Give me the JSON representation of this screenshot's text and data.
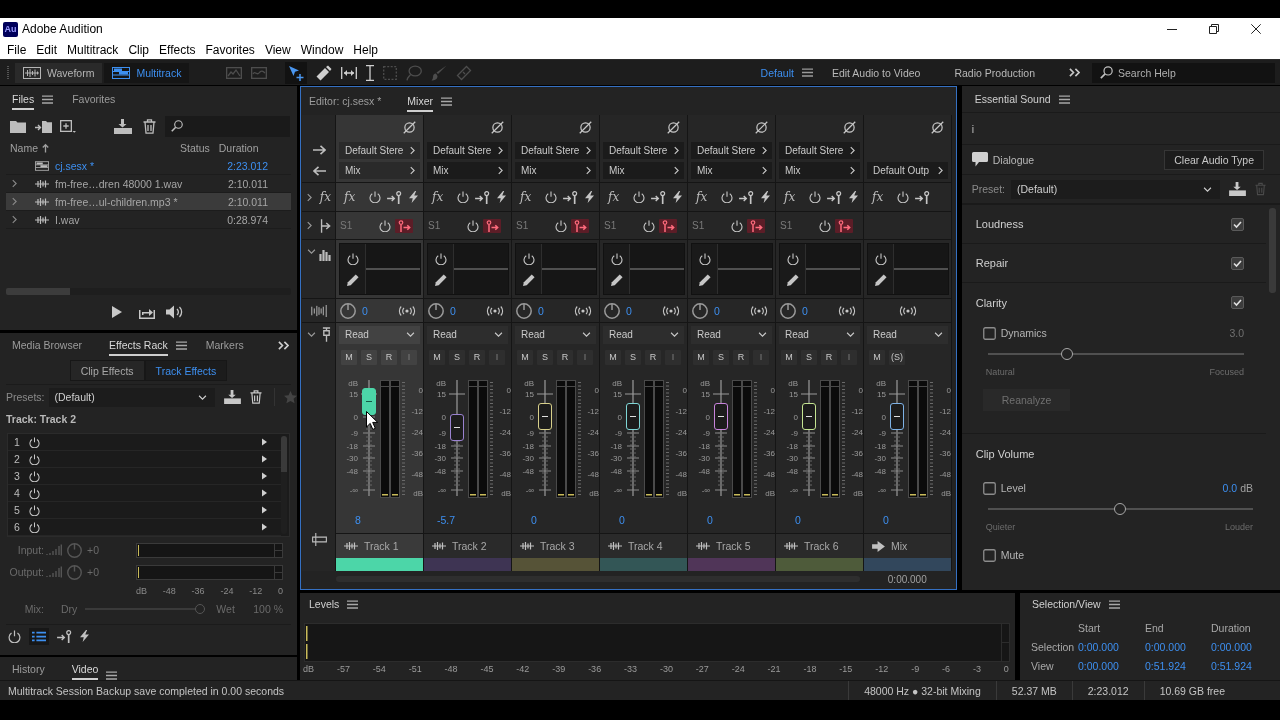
{
  "window": {
    "logo": "Au",
    "title": "Adobe Audition"
  },
  "menu": [
    "File",
    "Edit",
    "Multitrack",
    "Clip",
    "Effects",
    "Favorites",
    "View",
    "Window",
    "Help"
  ],
  "toolbar": {
    "modes": [
      {
        "kind": "waveform",
        "label": "Waveform",
        "selected": false
      },
      {
        "kind": "multitrack",
        "label": "Multitrack",
        "selected": true
      }
    ],
    "tools": [
      {
        "kind": "frequency",
        "selected": false,
        "disabled": true
      },
      {
        "kind": "pitch",
        "selected": false,
        "disabled": true
      },
      {
        "kind": "move",
        "selected": true,
        "disabled": false
      },
      {
        "kind": "razor",
        "selected": false,
        "disabled": false
      },
      {
        "kind": "slip",
        "selected": false,
        "disabled": false
      },
      {
        "kind": "time",
        "selected": false,
        "disabled": false
      },
      {
        "kind": "marquee",
        "selected": false,
        "disabled": true
      },
      {
        "kind": "lasso",
        "selected": false,
        "disabled": true
      },
      {
        "kind": "brush",
        "selected": false,
        "disabled": true
      },
      {
        "kind": "heal",
        "selected": false,
        "disabled": true
      }
    ],
    "workspaces": [
      {
        "label": "Default",
        "selected": true
      },
      {
        "label": "Edit Audio to Video",
        "selected": false
      },
      {
        "label": "Radio Production",
        "selected": false
      }
    ],
    "search": {
      "placeholder": "Search Help"
    }
  },
  "files_panel": {
    "tabs": [
      {
        "label": "Files",
        "selected": true
      },
      {
        "label": "Favorites",
        "selected": false
      }
    ],
    "columns": [
      "Name",
      "Status",
      "Duration"
    ],
    "rows": [
      {
        "kind": "session",
        "name": "cj.sesx *",
        "duration": "2:23.012",
        "selected": false
      },
      {
        "kind": "audio",
        "name": "fm-free…dren 48000 1.wav",
        "duration": "2:10.011",
        "selected": false,
        "expanded": false
      },
      {
        "kind": "audio",
        "name": "fm-free…ul-children.mp3 *",
        "duration": "2:10.011",
        "selected": true,
        "expanded": false
      },
      {
        "kind": "audio",
        "name": "I.wav",
        "duration": "0:28.974",
        "selected": false,
        "expanded": false
      }
    ]
  },
  "effects_rack": {
    "tabs": [
      {
        "label": "Media Browser",
        "selected": false
      },
      {
        "label": "Effects Rack",
        "selected": true
      },
      {
        "label": "Markers",
        "selected": false
      }
    ],
    "modes": [
      {
        "label": "Clip Effects",
        "selected": false
      },
      {
        "label": "Track Effects",
        "selected": true
      }
    ],
    "presets": {
      "label": "Presets:",
      "value": "(Default)",
      "favorite_disabled": true
    },
    "track_label": "Track: Track 2",
    "slots": [
      "1",
      "2",
      "3",
      "4",
      "5",
      "6"
    ],
    "input": {
      "label": "Input:",
      "value": "+0",
      "disabled": true
    },
    "output": {
      "label": "Output:",
      "value": "+0",
      "disabled": true
    },
    "meter_ticks": [
      "dB",
      "-48",
      "-36",
      "-24",
      "-12",
      "0"
    ],
    "mix": {
      "label": "Mix:",
      "dry": "Dry",
      "wet": "Wet",
      "reading": "100 %",
      "level": 1,
      "disabled": true
    },
    "buttons": [
      {
        "kind": "power",
        "selected": false
      },
      {
        "kind": "list",
        "selected": true
      },
      {
        "kind": "insert",
        "selected": false
      },
      {
        "kind": "bolt",
        "selected": false
      }
    ]
  },
  "bottom_tabs": [
    {
      "label": "History",
      "selected": false
    },
    {
      "label": "Video",
      "selected": true
    }
  ],
  "mixer": {
    "tabs": [
      {
        "label": "Editor: cj.sesx *",
        "selected": false
      },
      {
        "label": "Mixer",
        "selected": true
      }
    ],
    "side": {
      "fx": "fx",
      "sections": [
        {
          "kind": "fx",
          "expanded": false
        },
        {
          "kind": "sends",
          "expanded": false
        },
        {
          "kind": "eq",
          "expanded": true
        },
        {
          "kind": "automation",
          "expanded": true
        }
      ]
    },
    "channels": [
      {
        "kind": "track",
        "name": "Track 1",
        "selected": true,
        "color": "#4cd6a8",
        "input": "Default Stere",
        "output": "Mix",
        "fx": "fx",
        "send": "S1",
        "pan": "0",
        "automation": "Read",
        "buttons": [
          {
            "label": "M",
            "disabled": false
          },
          {
            "label": "S",
            "disabled": false
          },
          {
            "label": "R",
            "disabled": false
          },
          {
            "label": "I",
            "disabled": true
          }
        ],
        "fader_scale": [
          "dB",
          "15",
          "0",
          "-9",
          "-18",
          "-30",
          "-48",
          "-∞"
        ],
        "level": 0.81,
        "meter_scale": [
          "0",
          "-12",
          "-24",
          "-36",
          "-48",
          "dB"
        ],
        "volume": "8"
      },
      {
        "kind": "track",
        "name": "Track 2",
        "selected": false,
        "color": "#9a82d0",
        "input": "Default Stere",
        "output": "Mix",
        "fx": "fx",
        "send": "S1",
        "pan": "0",
        "automation": "Read",
        "buttons": [
          {
            "label": "M",
            "disabled": false
          },
          {
            "label": "S",
            "disabled": false
          },
          {
            "label": "R",
            "disabled": false
          },
          {
            "label": "I",
            "disabled": true
          }
        ],
        "fader_scale": [
          "dB",
          "15",
          "0",
          "-9",
          "-18",
          "-30",
          "-48",
          "-∞"
        ],
        "level": 0.59,
        "meter_scale": [
          "0",
          "-12",
          "-24",
          "-36",
          "-48",
          "dB"
        ],
        "volume": "-5.7"
      },
      {
        "kind": "track",
        "name": "Track 3",
        "selected": false,
        "color": "#d8d08a",
        "input": "Default Stere",
        "output": "Mix",
        "fx": "fx",
        "send": "S1",
        "pan": "0",
        "automation": "Read",
        "buttons": [
          {
            "label": "M",
            "disabled": false
          },
          {
            "label": "S",
            "disabled": false
          },
          {
            "label": "R",
            "disabled": false
          },
          {
            "label": "I",
            "disabled": true
          }
        ],
        "fader_scale": [
          "dB",
          "15",
          "0",
          "-9",
          "-18",
          "-30",
          "-48",
          "-∞"
        ],
        "level": 0.68,
        "meter_scale": [
          "0",
          "-12",
          "-24",
          "-36",
          "-48",
          "dB"
        ],
        "volume": "0"
      },
      {
        "kind": "track",
        "name": "Track 4",
        "selected": false,
        "color": "#7fd6d6",
        "input": "Default Stere",
        "output": "Mix",
        "fx": "fx",
        "send": "S1",
        "pan": "0",
        "automation": "Read",
        "buttons": [
          {
            "label": "M",
            "disabled": false
          },
          {
            "label": "S",
            "disabled": false
          },
          {
            "label": "R",
            "disabled": false
          },
          {
            "label": "I",
            "disabled": true
          }
        ],
        "fader_scale": [
          "dB",
          "15",
          "0",
          "-9",
          "-18",
          "-30",
          "-48",
          "-∞"
        ],
        "level": 0.68,
        "meter_scale": [
          "0",
          "-12",
          "-24",
          "-36",
          "-48",
          "dB"
        ],
        "volume": "0"
      },
      {
        "kind": "track",
        "name": "Track 5",
        "selected": false,
        "color": "#c884dc",
        "input": "Default Stere",
        "output": "Mix",
        "fx": "fx",
        "send": "S1",
        "pan": "0",
        "automation": "Read",
        "buttons": [
          {
            "label": "M",
            "disabled": false
          },
          {
            "label": "S",
            "disabled": false
          },
          {
            "label": "R",
            "disabled": false
          },
          {
            "label": "I",
            "disabled": true
          }
        ],
        "fader_scale": [
          "dB",
          "15",
          "0",
          "-9",
          "-18",
          "-30",
          "-48",
          "-∞"
        ],
        "level": 0.68,
        "meter_scale": [
          "0",
          "-12",
          "-24",
          "-36",
          "-48",
          "dB"
        ],
        "volume": "0"
      },
      {
        "kind": "track",
        "name": "Track 6",
        "selected": false,
        "color": "#c4e491",
        "input": "Default Stere",
        "output": "Mix",
        "fx": "fx",
        "send": "S1",
        "pan": "0",
        "automation": "Read",
        "buttons": [
          {
            "label": "M",
            "disabled": false
          },
          {
            "label": "S",
            "disabled": false
          },
          {
            "label": "R",
            "disabled": false
          },
          {
            "label": "I",
            "disabled": true
          }
        ],
        "fader_scale": [
          "dB",
          "15",
          "0",
          "-9",
          "-18",
          "-30",
          "-48",
          "-∞"
        ],
        "level": 0.68,
        "meter_scale": [
          "0",
          "-12",
          "-24",
          "-36",
          "-48",
          "dB"
        ],
        "volume": "0"
      },
      {
        "kind": "master",
        "name": "Mix",
        "selected": false,
        "color": "#7eb2e6",
        "output": "Default Outp",
        "fx": "fx",
        "automation": "Read",
        "buttons": [
          {
            "label": "M",
            "disabled": false
          },
          {
            "label": "(S)",
            "disabled": false
          }
        ],
        "fader_scale": [
          "dB",
          "15",
          "0",
          "-9",
          "-18",
          "-30",
          "-48",
          "-∞"
        ],
        "level": 0.68,
        "meter_scale": [
          "0",
          "-12",
          "-24",
          "-36",
          "-48",
          "dB"
        ],
        "volume": "0"
      }
    ],
    "time": "0:00.000"
  },
  "essential_sound": {
    "title": "Essential Sound",
    "clip": "i",
    "audio_type": "Dialogue",
    "clear_button": "Clear Audio Type",
    "preset": {
      "label": "Preset:",
      "value": "(Default)",
      "delete_disabled": true
    },
    "sections": [
      {
        "title": "Loudness",
        "checked": true
      },
      {
        "title": "Repair",
        "checked": true
      },
      {
        "title": "Clarity",
        "checked": true,
        "dynamics": {
          "label": "Dynamics",
          "checked": false,
          "reading": "3.0",
          "level": 0.3,
          "min_label": "Natural",
          "max_label": "Focused"
        },
        "action": {
          "label": "Reanalyze",
          "disabled": true
        }
      }
    ],
    "clip_volume": {
      "title": "Clip Volume",
      "volume": {
        "label": "Level",
        "checked": false,
        "value": "0.0",
        "unit": "dB",
        "level": 0.5,
        "min_label": "Quieter",
        "max_label": "Louder"
      },
      "mute": {
        "label": "Mute",
        "checked": false
      }
    }
  },
  "levels": {
    "title": "Levels",
    "ticks": [
      "dB",
      "-57",
      "-54",
      "-51",
      "-48",
      "-45",
      "-42",
      "-39",
      "-36",
      "-33",
      "-30",
      "-27",
      "-24",
      "-21",
      "-18",
      "-15",
      "-12",
      "-9",
      "-6",
      "-3",
      "0"
    ]
  },
  "selection_view": {
    "title": "Selection/View",
    "columns": [
      "Start",
      "End",
      "Duration"
    ],
    "rows": [
      {
        "label": "Selection",
        "values": [
          "0:00.000",
          "0:00.000",
          "0:00.000"
        ]
      },
      {
        "label": "View",
        "values": [
          "0:00.000",
          "0:51.924",
          "0:51.924"
        ]
      }
    ]
  },
  "status_bar": {
    "message": "Multitrack Session Backup save completed in 0.00 seconds",
    "items": [
      "48000 Hz ● 32-bit Mixing",
      "52.37 MB",
      "2:23.012",
      "10.69 GB free"
    ]
  }
}
